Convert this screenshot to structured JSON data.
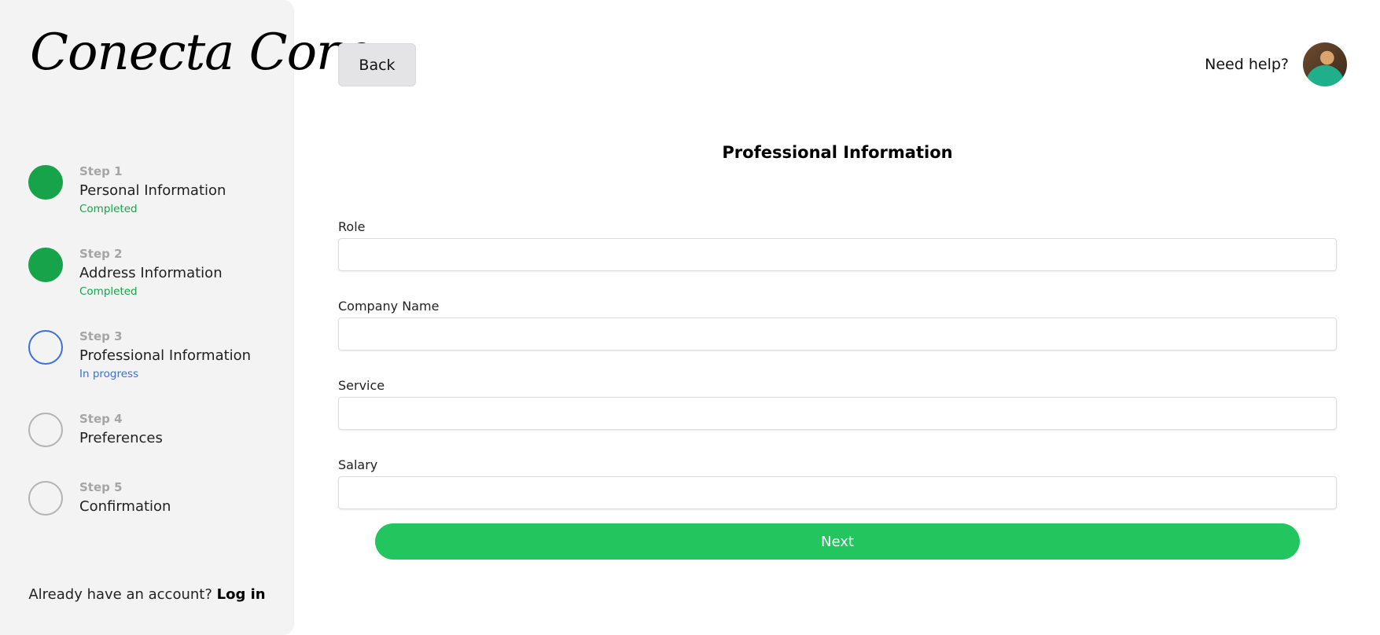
{
  "brand": {
    "logo_text": "Conecta Corp"
  },
  "steps": [
    {
      "num": "Step 1",
      "title": "Personal Information",
      "status": "Completed",
      "state": "done"
    },
    {
      "num": "Step 2",
      "title": "Address Information",
      "status": "Completed",
      "state": "done"
    },
    {
      "num": "Step 3",
      "title": "Professional Information",
      "status": "In progress",
      "state": "active"
    },
    {
      "num": "Step 4",
      "title": "Preferences",
      "status": "",
      "state": "pending"
    },
    {
      "num": "Step 5",
      "title": "Confirmation",
      "status": "",
      "state": "pending"
    }
  ],
  "login": {
    "prompt": "Already have an account?",
    "link": "Log in"
  },
  "header": {
    "back_label": "Back",
    "help_label": "Need help?"
  },
  "form": {
    "title": "Professional Information",
    "fields": [
      {
        "label": "Role",
        "value": ""
      },
      {
        "label": "Company Name",
        "value": ""
      },
      {
        "label": "Service",
        "value": ""
      },
      {
        "label": "Salary",
        "value": ""
      }
    ],
    "next_label": "Next"
  },
  "colors": {
    "completed": "#16a34a",
    "in_progress": "#3b6fdb",
    "pending": "#b3b3b3",
    "next_button": "#22c55e",
    "sidebar_bg": "#f3f3f3"
  }
}
